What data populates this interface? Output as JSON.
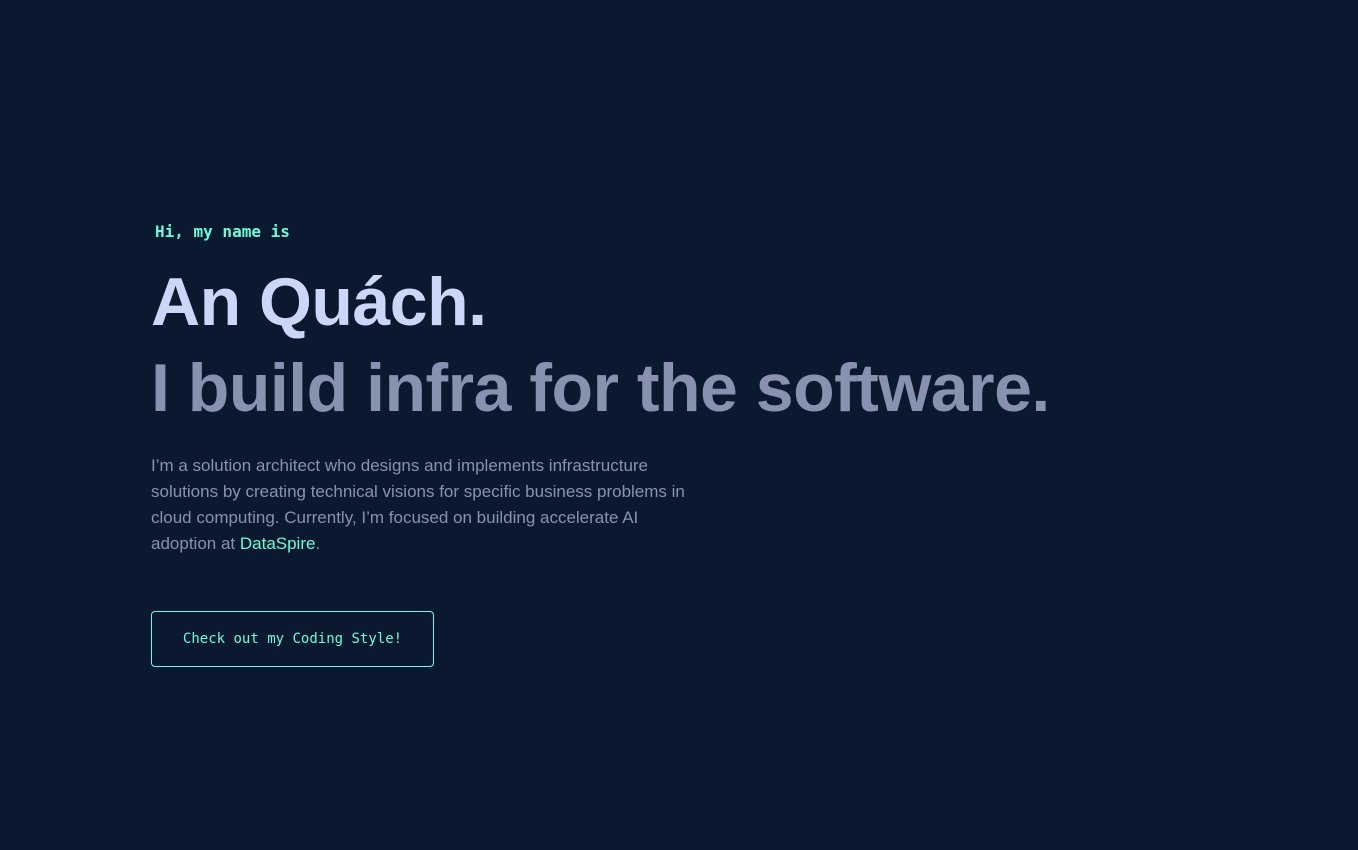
{
  "hero": {
    "intro": "Hi, my name is",
    "name": "An Quách.",
    "tagline": "I build infra for the software.",
    "bio_before": "I’m a solution architect who designs and implements infrastructure solutions by creating technical visions for specific business problems in cloud computing. Currently, I’m focused on building accelerate AI adoption at ",
    "bio_link": "DataSpire",
    "bio_after": ".",
    "cta_label": "Check out my Coding Style!"
  },
  "colors": {
    "background": "#0a192f",
    "accent": "#64ffda",
    "heading": "#ccd6f6",
    "subtext": "#8892b0"
  }
}
